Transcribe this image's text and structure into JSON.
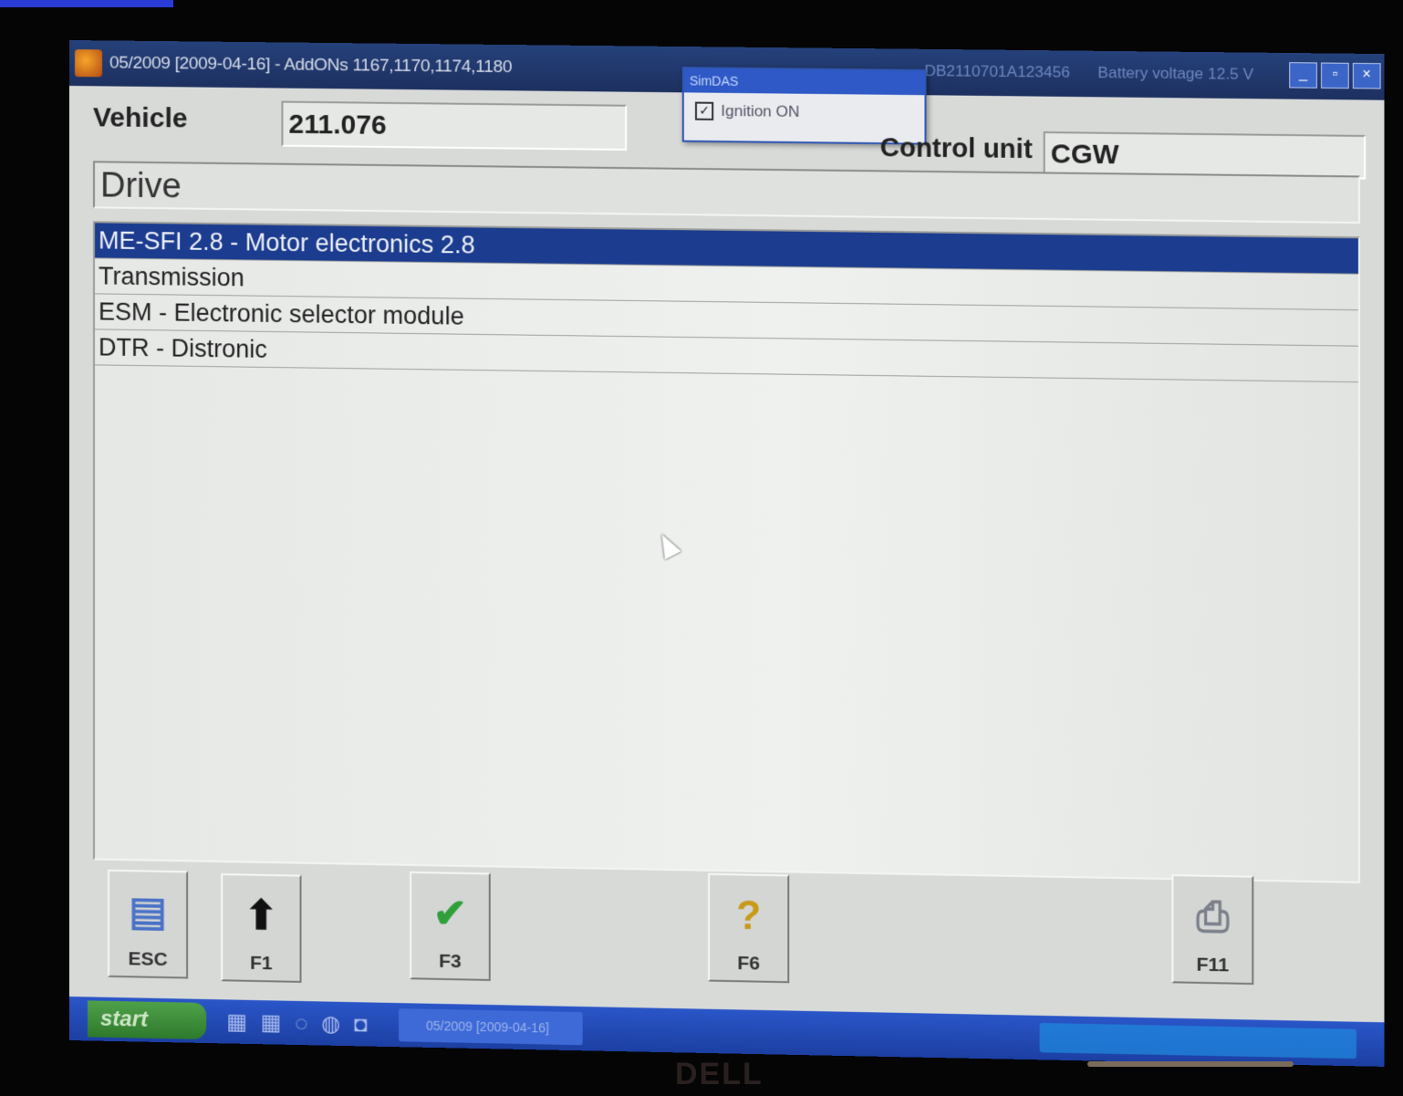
{
  "window": {
    "title": "05/2009 [2009-04-16] - AddONs  1167,1170,1174,1180",
    "vin_text": "DB2110701A123456",
    "battery_text": "Battery voltage  12.5 V",
    "controls": [
      "_",
      "▫",
      "×"
    ]
  },
  "popup": {
    "title": "SimDAS",
    "option_label": "Ignition ON",
    "option_checked": true
  },
  "header": {
    "vehicle_label": "Vehicle",
    "vehicle_value": "211.076",
    "control_unit_label": "Control unit",
    "control_unit_value": "CGW",
    "section": "Drive"
  },
  "list": {
    "items": [
      {
        "label": "ME-SFI 2.8 - Motor electronics 2.8",
        "selected": true
      },
      {
        "label": "Transmission",
        "selected": false
      },
      {
        "label": "ESM - Electronic selector module",
        "selected": false
      },
      {
        "label": "DTR - Distronic",
        "selected": false
      }
    ]
  },
  "fkeys": [
    {
      "label": "ESC",
      "icon": "exit-door-icon"
    },
    {
      "label": "F1",
      "icon": "arrow-up-icon"
    },
    {
      "label": "F3",
      "icon": "checkmark-icon"
    },
    {
      "label": "F6",
      "icon": "help-question-icon"
    },
    {
      "label": "F11",
      "icon": "printer-icon"
    }
  ],
  "taskbar": {
    "start_label": "start",
    "task_label": "05/2009 [2009-04-16]"
  },
  "monitor": {
    "brand": "DELL"
  },
  "colors": {
    "selection": "#1b3c8f",
    "titlebar": "#25417a",
    "taskbar": "#2a56c8"
  }
}
